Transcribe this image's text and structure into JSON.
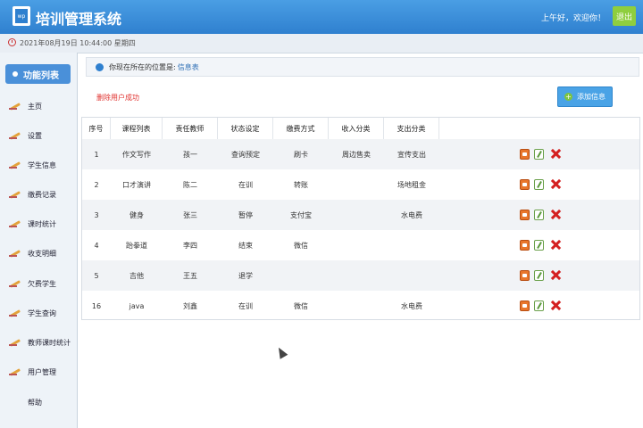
{
  "header": {
    "logo_text": "wp",
    "title": "培训管理系统",
    "greeting": "上午好，欢迎你！",
    "exit_label": "退出"
  },
  "datebar": {
    "date": "2021年08月19日 10:44:00 星期四"
  },
  "sidebar": {
    "title": "功能列表",
    "items": [
      {
        "label": "主页"
      },
      {
        "label": "设置"
      },
      {
        "label": "学生信息"
      },
      {
        "label": "缴费记录"
      },
      {
        "label": "课时统计"
      },
      {
        "label": "收支明细"
      },
      {
        "label": "欠费学生"
      },
      {
        "label": "学生查询"
      },
      {
        "label": "教师课时统计"
      },
      {
        "label": "用户管理"
      },
      {
        "label": "帮助"
      }
    ]
  },
  "breadcrumb": {
    "prefix": "你现在所在的位置是:",
    "current": "信息表"
  },
  "message": "删除用户成功",
  "add_button": {
    "label": "添加信息"
  },
  "table": {
    "headers": [
      "序号",
      "课程列表",
      "责任教师",
      "状态设定",
      "缴费方式",
      "收入分类",
      "支出分类"
    ],
    "rows": [
      [
        "1",
        "作文写作",
        "孩一",
        "查询预定",
        "刷卡",
        "周边售卖",
        "宣传支出"
      ],
      [
        "2",
        "口才演讲",
        "陈二",
        "在训",
        "转账",
        "",
        "场地租金"
      ],
      [
        "3",
        "健身",
        "张三",
        "暂停",
        "支付宝",
        "",
        "水电费"
      ],
      [
        "4",
        "跆拳道",
        "李四",
        "结束",
        "微信",
        "",
        ""
      ],
      [
        "5",
        "吉他",
        "王五",
        "退学",
        "",
        "",
        ""
      ],
      [
        "16",
        "java",
        "刘鑫",
        "在训",
        "微信",
        "",
        "水电费"
      ]
    ]
  }
}
